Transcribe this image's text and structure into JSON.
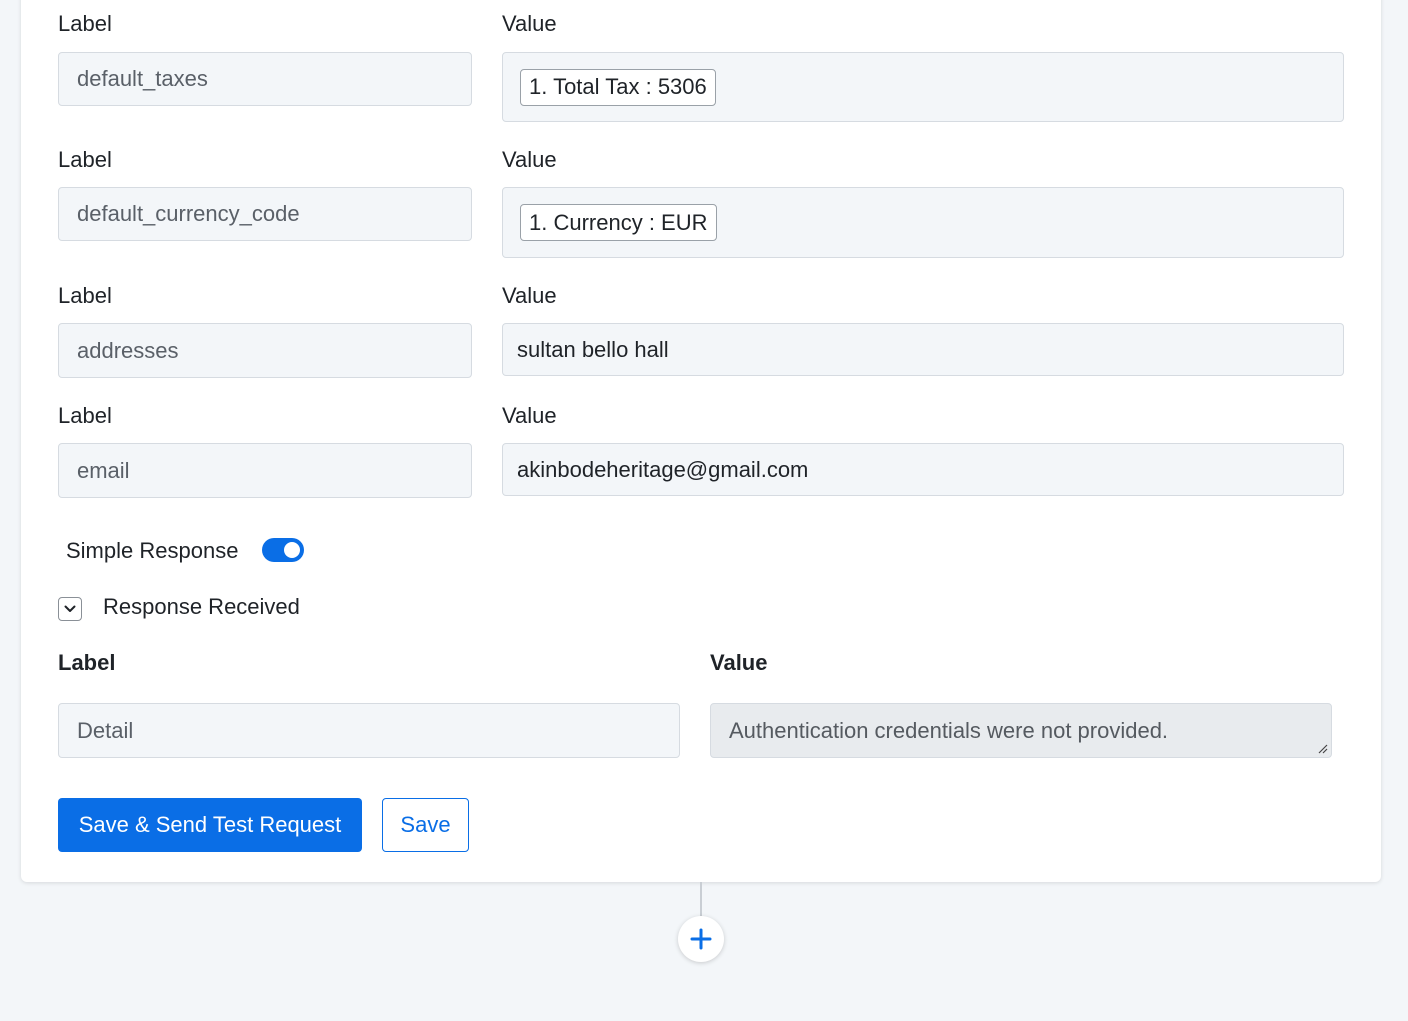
{
  "rows": [
    {
      "label_heading": "Label",
      "value_heading": "Value",
      "label": "default_taxes",
      "value_chip": "1. Total Tax : 5306"
    },
    {
      "label_heading": "Label",
      "value_heading": "Value",
      "label": "default_currency_code",
      "value_chip": "1. Currency : EUR"
    },
    {
      "label_heading": "Label",
      "value_heading": "Value",
      "label": "addresses",
      "value": "sultan bello hall"
    },
    {
      "label_heading": "Label",
      "value_heading": "Value",
      "label": "email",
      "value": "akinbodeheritage@gmail.com"
    }
  ],
  "simple_response": {
    "label": "Simple Response",
    "enabled": true
  },
  "response_received": {
    "title": "Response Received",
    "label_heading": "Label",
    "value_heading": "Value",
    "label": "Detail",
    "value": "Authentication credentials were not provided."
  },
  "buttons": {
    "save_send": "Save & Send Test Request",
    "save": "Save"
  },
  "colors": {
    "accent": "#0a6ee6",
    "page_bg": "#f3f6f9",
    "field_bg": "#f3f6f9"
  },
  "icons": {
    "collapse": "chevron-down-icon",
    "add_step": "plus-icon"
  }
}
